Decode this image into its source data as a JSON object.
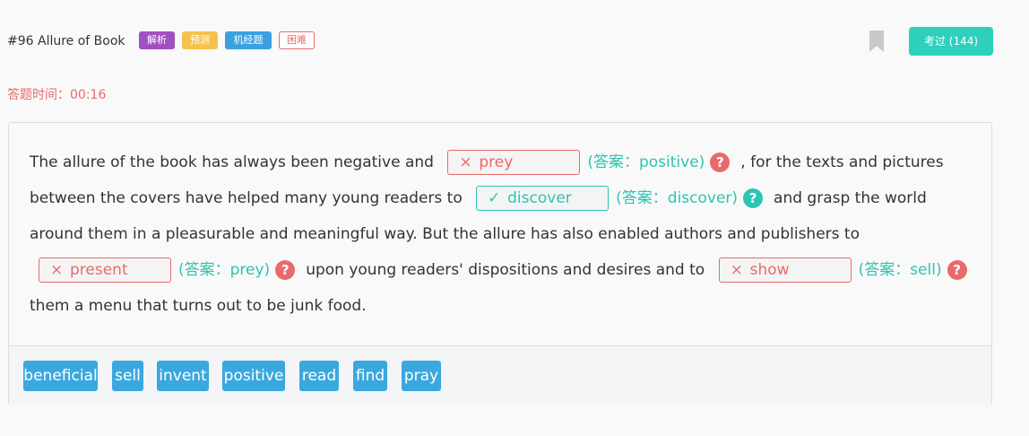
{
  "header": {
    "title": "#96 Allure of Book",
    "tags": [
      "解析",
      "预测",
      "机经题",
      "困难"
    ],
    "passed_label": "考过 (144)"
  },
  "timer": "答题时间：00:16",
  "passage": {
    "t1": "The allure of the book has always been negative and",
    "t2": ", for the texts and pictures between the covers have helped many young readers to",
    "t3": "and grasp the world around them in a pleasurable and meaningful way. But the allure has also enabled authors and publishers to",
    "t4": "upon young readers' dispositions and desires and to",
    "t5": "them a menu that turns out to be junk food.",
    "blanks": [
      {
        "user": "prey",
        "answer": "(答案：positive)",
        "status": "wrong",
        "mark": "×"
      },
      {
        "user": "discover",
        "answer": "(答案：discover)",
        "status": "correct",
        "mark": "✓"
      },
      {
        "user": "present",
        "answer": "(答案：prey)",
        "status": "wrong",
        "mark": "×"
      },
      {
        "user": "show",
        "answer": "(答案：sell)",
        "status": "wrong",
        "mark": "×"
      }
    ],
    "help_glyph": "?"
  },
  "word_bank": [
    "beneficial",
    "sell",
    "invent",
    "positive",
    "read",
    "find",
    "pray"
  ],
  "colors": {
    "accent": "#2dd0bd",
    "wrong": "#e96a6a",
    "correct": "#2dc4b2",
    "word_chip": "#3aa8df"
  }
}
